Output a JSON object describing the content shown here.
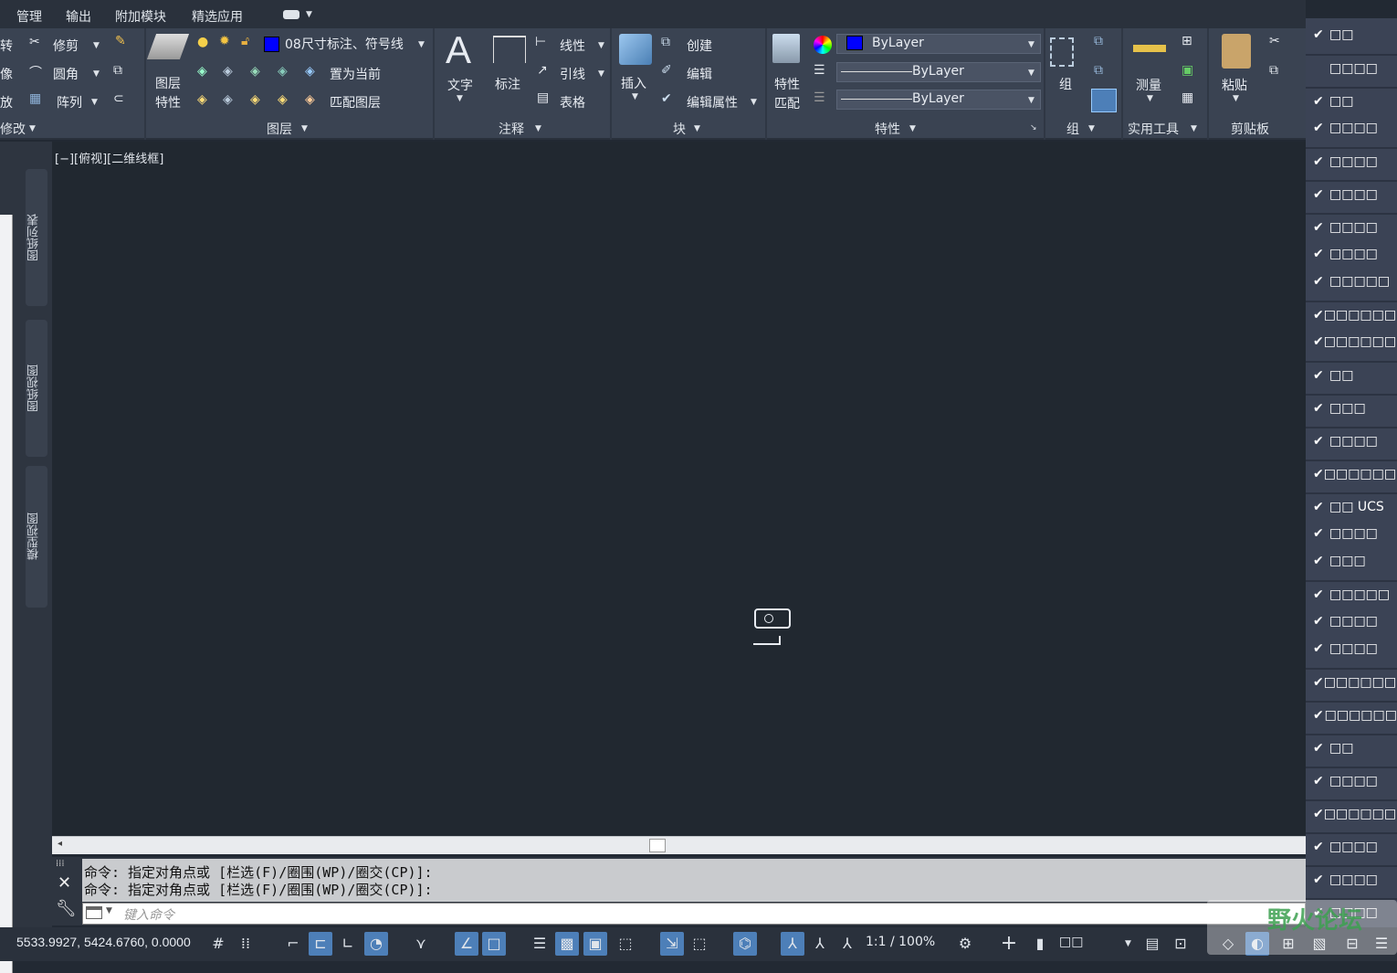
{
  "tabs": [
    "管理",
    "输出",
    "附加模块",
    "精选应用"
  ],
  "ribbon": {
    "modify": {
      "items": [
        "转",
        "像",
        "放",
        "修剪",
        "圆角",
        "阵列"
      ],
      "label": "修改"
    },
    "layers": {
      "props_label": [
        "图层",
        "特性"
      ],
      "current_layer": "08尺寸标注、符号线",
      "set_current": "置为当前",
      "match_layer": "匹配图层",
      "label": "图层"
    },
    "annotation": {
      "text": "文字",
      "dim": "标注",
      "linear": "线性",
      "leader": "引线",
      "table": "表格",
      "label": "注释"
    },
    "block": {
      "insert": "插入",
      "create": "创建",
      "edit": "编辑",
      "edit_attr": "编辑属性",
      "label": "块"
    },
    "properties": {
      "match": [
        "特性",
        "匹配"
      ],
      "color": "ByLayer",
      "linetype": "ByLayer",
      "lineweight": "ByLayer",
      "label": "特性",
      "color_swatch": "#0000ff"
    },
    "groups": {
      "group": "组",
      "label": "组"
    },
    "utilities": {
      "measure": "测量",
      "label": "实用工具"
    },
    "clipboard": {
      "paste": "粘贴",
      "label": "剪贴板"
    }
  },
  "viewport": {
    "label": "[−][俯视][二维线框]"
  },
  "left_palettes": [
    "图纸列表",
    "图纸视图",
    "模型视图"
  ],
  "command": {
    "history": [
      "命令: 指定对角点或 [栏选(F)/圈围(WP)/圈交(CP)]:",
      "命令: 指定对角点或 [栏选(F)/圈围(WP)/圈交(CP)]:"
    ],
    "placeholder": "键入命令"
  },
  "status": {
    "coords": "5533.9927, 5424.6760, 0.0000",
    "scale": "1:1 / 100%",
    "units": "□□"
  },
  "menu": {
    "items": [
      {
        "label": "□□",
        "checked": true,
        "sep": false
      },
      {
        "label": "□□□□",
        "checked": false,
        "sep": true
      },
      {
        "label": "□□",
        "checked": true,
        "sep": true
      },
      {
        "label": "□□□□",
        "checked": true,
        "sep": false
      },
      {
        "label": "□□□□",
        "checked": true,
        "sep": true
      },
      {
        "label": "□□□□",
        "checked": true,
        "sep": true
      },
      {
        "label": "□□□□",
        "checked": true,
        "sep": true
      },
      {
        "label": "□□□□",
        "checked": true,
        "sep": false
      },
      {
        "label": "□□□□□",
        "checked": true,
        "sep": false
      },
      {
        "label": "□□□□□□□",
        "checked": true,
        "sep": true
      },
      {
        "label": "□□□□□□□",
        "checked": true,
        "sep": false
      },
      {
        "label": "□□",
        "checked": true,
        "sep": true
      },
      {
        "label": "□□□",
        "checked": true,
        "sep": true
      },
      {
        "label": "□□□□",
        "checked": true,
        "sep": true
      },
      {
        "label": "□□□□□□□",
        "checked": true,
        "sep": true
      },
      {
        "label": "□□ UCS",
        "checked": true,
        "sep": true
      },
      {
        "label": "□□□□",
        "checked": true,
        "sep": false
      },
      {
        "label": "□□□",
        "checked": true,
        "sep": false
      },
      {
        "label": "□□□□□",
        "checked": true,
        "sep": true
      },
      {
        "label": "□□□□",
        "checked": true,
        "sep": false
      },
      {
        "label": "□□□□",
        "checked": true,
        "sep": false
      },
      {
        "label": "□□□□□□□",
        "checked": true,
        "sep": true
      },
      {
        "label": "□□□□□□",
        "checked": true,
        "sep": true
      },
      {
        "label": "□□",
        "checked": true,
        "sep": true
      },
      {
        "label": "□□□□",
        "checked": true,
        "sep": true
      },
      {
        "label": "□□□□□□□",
        "checked": true,
        "sep": true
      },
      {
        "label": "□□□□",
        "checked": true,
        "sep": true
      },
      {
        "label": "□□□□",
        "checked": true,
        "sep": true
      },
      {
        "label": "□□□□",
        "checked": true,
        "sep": true
      }
    ]
  },
  "watermark": "野火论坛"
}
